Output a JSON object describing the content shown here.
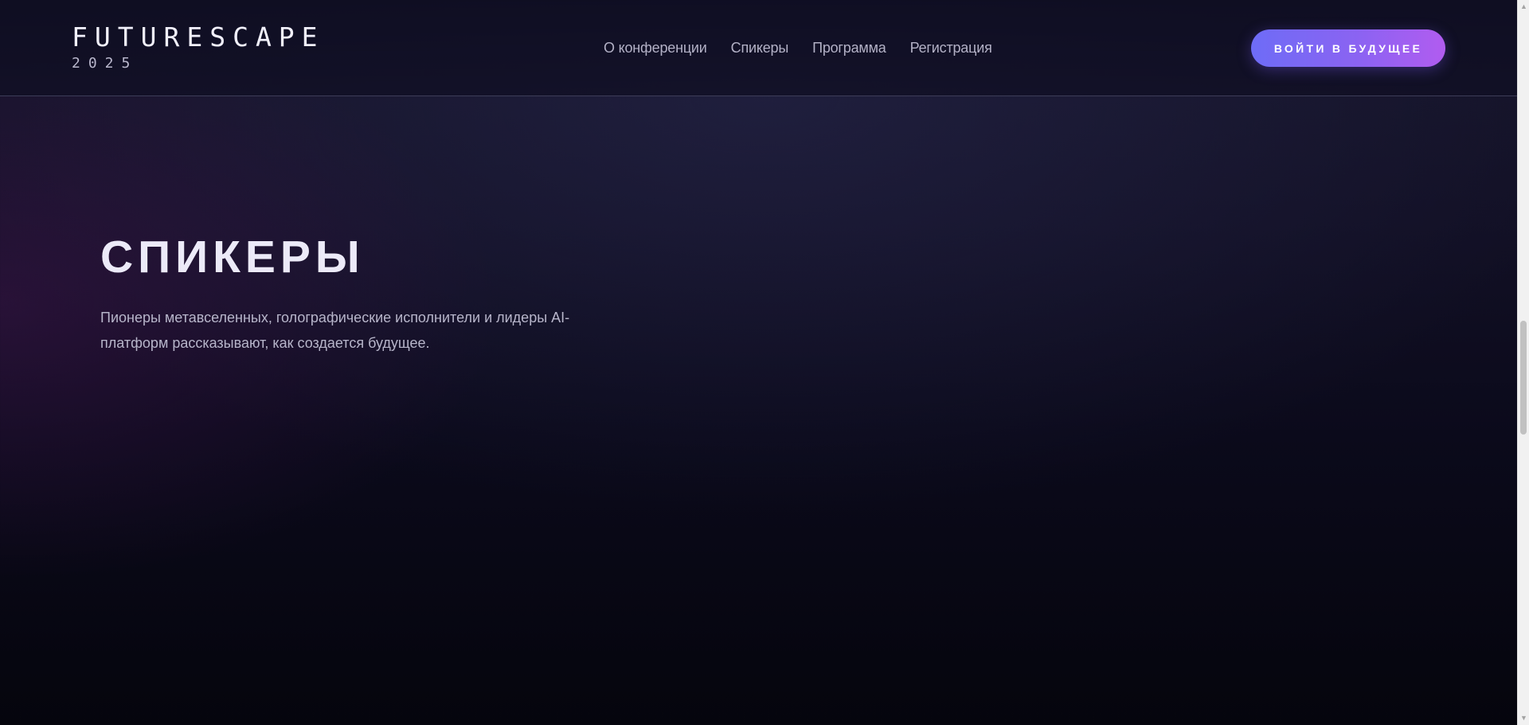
{
  "logo": {
    "title": "FUTURESCAPE",
    "year": "2025"
  },
  "nav": {
    "items": [
      {
        "label": "О конференции"
      },
      {
        "label": "Спикеры"
      },
      {
        "label": "Программа"
      },
      {
        "label": "Регистрация"
      }
    ]
  },
  "cta": {
    "label": "ВОЙТИ В БУДУЩЕЕ"
  },
  "hero": {
    "title": "СПИКЕРЫ",
    "description": "Пионеры метавселенных, голографические исполнители и лидеры AI-платформ рассказывают, как создается будущее."
  },
  "scrollbar": {
    "up_icon": "triangle-up",
    "down_icon": "triangle-down"
  },
  "colors": {
    "background_top": "#17162c",
    "background_bottom": "#05050d",
    "accent_start": "#6e6cf6",
    "accent_end": "#b15cf0",
    "text_primary": "#eceaf8",
    "text_muted": "#b3b1c6"
  }
}
